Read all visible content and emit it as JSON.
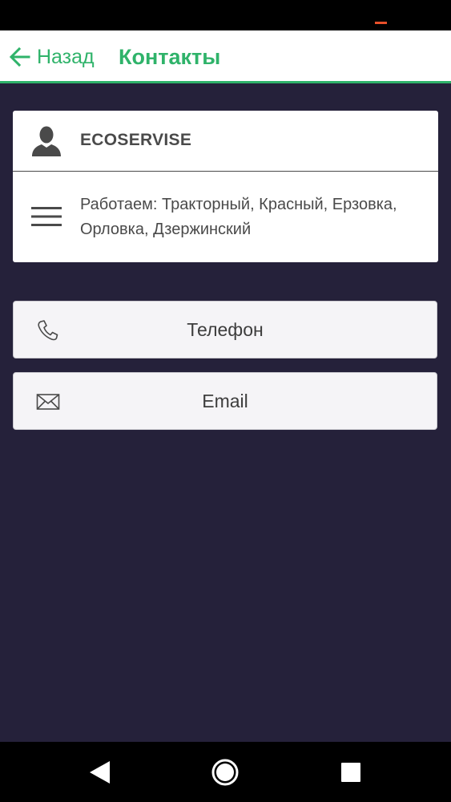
{
  "header": {
    "back_label": "Назад",
    "title": "Контакты"
  },
  "contact_card": {
    "name": "ECOSERVISE",
    "description": "Работаем: Тракторный, Красный, Ерзовка, Орловка, Дзержинский"
  },
  "actions": {
    "phone_label": "Телефон",
    "email_label": "Email"
  },
  "icons": {
    "back": "arrow-left-icon",
    "person": "person-icon",
    "menu": "menu-icon",
    "phone": "phone-icon",
    "email": "envelope-icon",
    "nav_back": "triangle-back-icon",
    "nav_home": "circle-home-icon",
    "nav_recent": "square-recent-icon"
  },
  "colors": {
    "accent": "#2fb36a",
    "background": "#25213a",
    "status_indicator": "#e8502a"
  }
}
